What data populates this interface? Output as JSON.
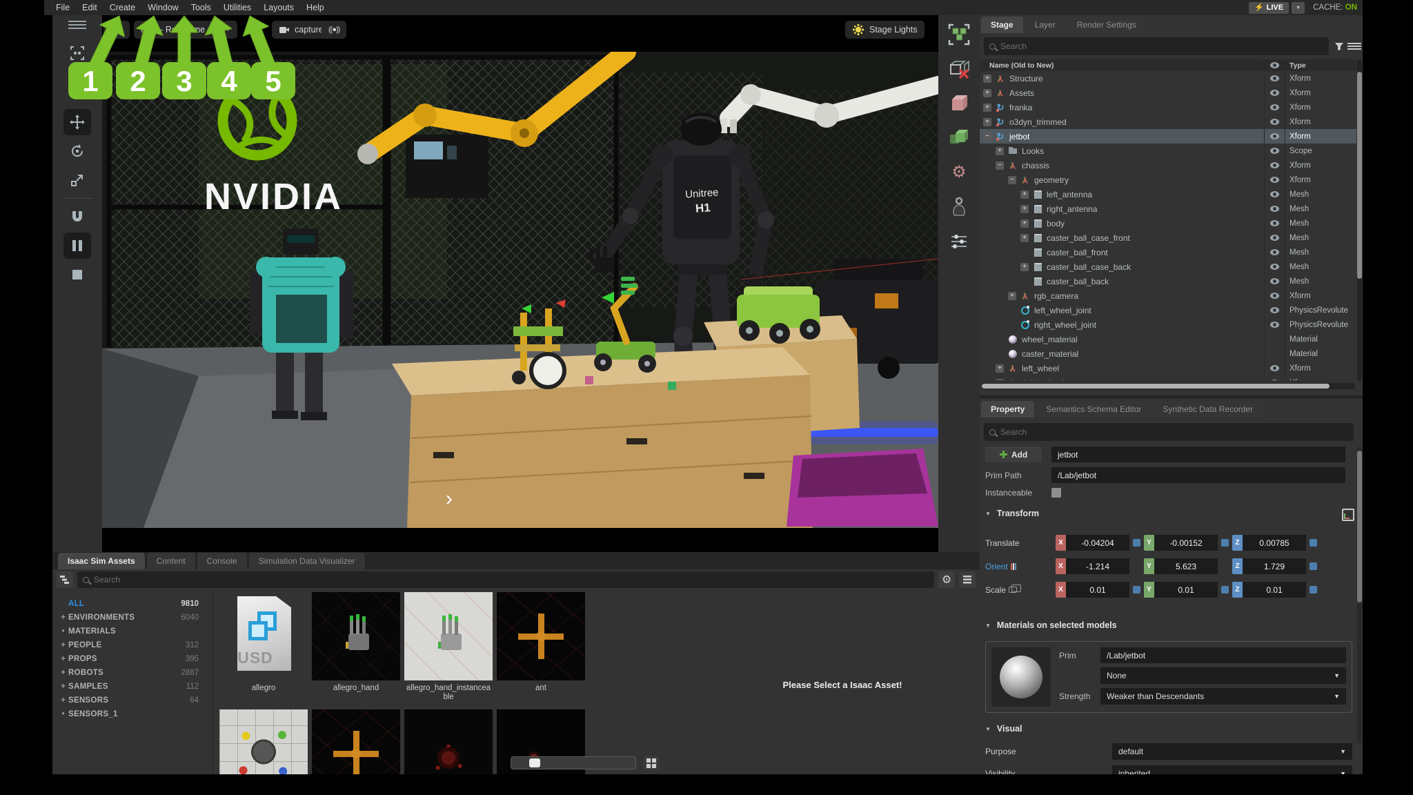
{
  "menubar": {
    "items": [
      "File",
      "Edit",
      "Create",
      "Window",
      "Tools",
      "Utilities",
      "Layouts",
      "Help"
    ],
    "live_label": "LIVE",
    "cache_label": "CACHE:",
    "cache_value": "ON"
  },
  "icons": {
    "lightning": "⚡",
    "signal": "((●))",
    "dropdown": "▼",
    "section_caret": "▼",
    "live_chevron": "▼"
  },
  "annotations": {
    "badges": [
      "1",
      "2",
      "3",
      "4",
      "5"
    ]
  },
  "viewport": {
    "renderer_button": "RTX - Real-Time",
    "capture_button": "capture",
    "stage_lights_button": "Stage Lights",
    "scene": {
      "logo_text": "NVIDIA",
      "robot_brand": "Unitree",
      "robot_model": "H1"
    }
  },
  "stage_panel": {
    "tabs": [
      {
        "label": "Stage",
        "active": true
      },
      {
        "label": "Layer"
      },
      {
        "label": "Render Settings"
      }
    ],
    "search_placeholder": "Search",
    "columns": {
      "name": "Name (Old to New)",
      "type": "Type"
    },
    "tree": [
      {
        "name": "Structure",
        "type": "Xform",
        "icon": "xform",
        "exp": "+",
        "indent": 0
      },
      {
        "name": "Assets",
        "type": "Xform",
        "icon": "xform",
        "exp": "+",
        "indent": 0
      },
      {
        "name": "franka",
        "type": "Xform",
        "icon": "robot",
        "exp": "+",
        "indent": 0
      },
      {
        "name": "o3dyn_trimmed",
        "type": "Xform",
        "icon": "robot",
        "exp": "+",
        "indent": 0
      },
      {
        "name": "jetbot",
        "type": "Xform",
        "icon": "robot",
        "exp": "-",
        "indent": 0,
        "selected": true
      },
      {
        "name": "Looks",
        "type": "Scope",
        "icon": "folder",
        "exp": "+",
        "indent": 1
      },
      {
        "name": "chassis",
        "type": "Xform",
        "icon": "xform",
        "exp": "-",
        "indent": 1
      },
      {
        "name": "geometry",
        "type": "Xform",
        "icon": "xform",
        "exp": "-",
        "indent": 2
      },
      {
        "name": "left_antenna",
        "type": "Mesh",
        "icon": "mesh",
        "exp": "+",
        "indent": 3
      },
      {
        "name": "right_antenna",
        "type": "Mesh",
        "icon": "mesh",
        "exp": "+",
        "indent": 3
      },
      {
        "name": "body",
        "type": "Mesh",
        "icon": "mesh",
        "exp": "+",
        "indent": 3
      },
      {
        "name": "caster_ball_case_front",
        "type": "Mesh",
        "icon": "mesh",
        "exp": "+",
        "indent": 3
      },
      {
        "name": "caster_ball_front",
        "type": "Mesh",
        "icon": "mesh",
        "exp": "",
        "indent": 3
      },
      {
        "name": "caster_ball_case_back",
        "type": "Mesh",
        "icon": "mesh",
        "exp": "+",
        "indent": 3
      },
      {
        "name": "caster_ball_back",
        "type": "Mesh",
        "icon": "mesh",
        "exp": "",
        "indent": 3
      },
      {
        "name": "rgb_camera",
        "type": "Xform",
        "icon": "xform",
        "exp": "+",
        "indent": 2
      },
      {
        "name": "left_wheel_joint",
        "type": "PhysicsRevolute",
        "icon": "joint",
        "exp": "",
        "indent": 2
      },
      {
        "name": "right_wheel_joint",
        "type": "PhysicsRevolute",
        "icon": "joint",
        "exp": "",
        "indent": 2
      },
      {
        "name": "wheel_material",
        "type": "Material",
        "icon": "material",
        "exp": "",
        "indent": 1,
        "eye": false
      },
      {
        "name": "caster_material",
        "type": "Material",
        "icon": "material",
        "exp": "",
        "indent": 1,
        "eye": false
      },
      {
        "name": "left_wheel",
        "type": "Xform",
        "icon": "xform",
        "exp": "+",
        "indent": 1
      },
      {
        "name": "right_wheel",
        "type": "Xform",
        "icon": "xform",
        "exp": "+",
        "indent": 1
      }
    ]
  },
  "property_panel": {
    "tabs": [
      {
        "label": "Property",
        "active": true
      },
      {
        "label": "Semantics Schema Editor"
      },
      {
        "label": "Synthetic Data Recorder"
      }
    ],
    "search_placeholder": "Search",
    "add_button": "Add",
    "prim_name": "jetbot",
    "prim_path_label": "Prim Path",
    "prim_path_value": "/Lab/jetbot",
    "instanceable_label": "Instanceable",
    "transform": {
      "title": "Transform",
      "axis": {
        "x": "X",
        "y": "Y",
        "z": "Z"
      },
      "translate": {
        "label": "Translate",
        "x": "-0.04204",
        "y": "-0.00152",
        "z": "0.00785"
      },
      "orient": {
        "label": "Orient",
        "x": "-1.214",
        "y": "5.623",
        "z": "1.729"
      },
      "scale": {
        "label": "Scale",
        "x": "0.01",
        "y": "0.01",
        "z": "0.01"
      }
    },
    "materials": {
      "title": "Materials on selected models",
      "prim_label": "Prim",
      "prim_value": "/Lab/jetbot",
      "binding_value": "None",
      "strength_label": "Strength",
      "strength_value": "Weaker than Descendants"
    },
    "visual": {
      "title": "Visual",
      "purpose_label": "Purpose",
      "purpose_value": "default",
      "visibility_label": "Visibility",
      "visibility_value": "inherited"
    }
  },
  "bottom_panel": {
    "tabs": [
      {
        "label": "Isaac Sim Assets",
        "active": true
      },
      {
        "label": "Content"
      },
      {
        "label": "Console"
      },
      {
        "label": "Simulation Data Visualizer"
      }
    ],
    "search_placeholder": "Search",
    "message": "Please Select a Isaac Asset!",
    "categories": [
      {
        "prefix": "",
        "label": "ALL",
        "count": "9810",
        "active": true
      },
      {
        "prefix": "+",
        "label": "ENVIRONMENTS",
        "count": "6040"
      },
      {
        "prefix": "•",
        "label": "MATERIALS",
        "count": ""
      },
      {
        "prefix": "+",
        "label": "PEOPLE",
        "count": "312"
      },
      {
        "prefix": "+",
        "label": "PROPS",
        "count": "395"
      },
      {
        "prefix": "+",
        "label": "ROBOTS",
        "count": "2887"
      },
      {
        "prefix": "+",
        "label": "SAMPLES",
        "count": "112"
      },
      {
        "prefix": "+",
        "label": "SENSORS",
        "count": "64"
      },
      {
        "prefix": "•",
        "label": "SENSORS_1",
        "count": ""
      }
    ],
    "assets_row1": [
      {
        "label": "allegro",
        "thumb": "usd",
        "badge": "USD"
      },
      {
        "label": "allegro_hand",
        "thumb": "hand-dark"
      },
      {
        "label": "allegro_hand_instanceable",
        "thumb": "hand-light"
      },
      {
        "label": "ant",
        "thumb": "cross-dark"
      }
    ],
    "assets_row2": [
      {
        "thumb": "ant-light"
      },
      {
        "thumb": "cross-dark"
      },
      {
        "thumb": "spider-dark"
      },
      {
        "thumb": "robot-dark"
      }
    ]
  },
  "colors": {
    "accent_green": "#76b900",
    "selection": "#4e585d",
    "axis_x": "#bb6460",
    "axis_y": "#79a86b",
    "axis_z": "#5e8fc4",
    "live_bolt": "#ffd21e",
    "cache_on": "#76b900"
  }
}
